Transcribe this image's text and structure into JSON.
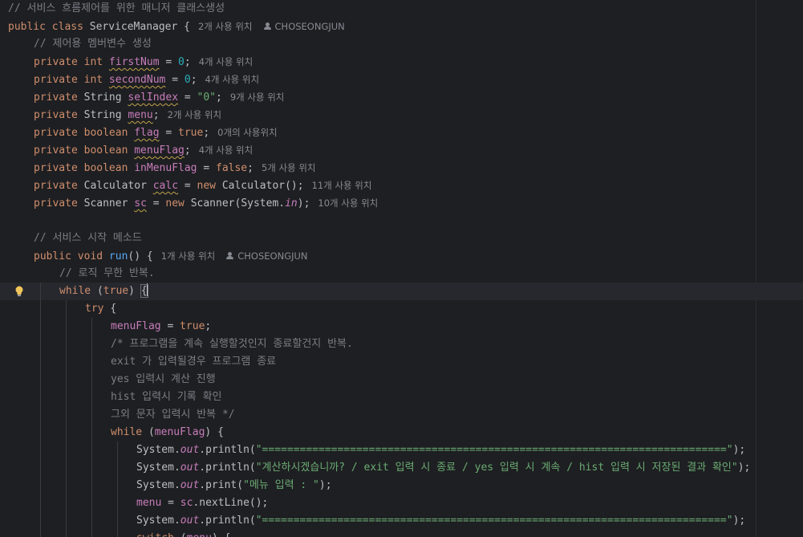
{
  "editor": {
    "lines": [
      {
        "indent": 0,
        "tokens": [
          {
            "t": "// 서비스 흐름제어를 위한 매니저 클래스생성",
            "c": "cmt"
          }
        ]
      },
      {
        "indent": 0,
        "tokens": [
          {
            "t": "public class ",
            "c": "kw"
          },
          {
            "t": "ServiceManager {"
          }
        ],
        "hint": "2개 사용 위치",
        "author": "CHOSEONGJUN"
      },
      {
        "indent": 1,
        "tokens": [
          {
            "t": "// 제어용 멤버변수 생성",
            "c": "cmt"
          }
        ]
      },
      {
        "indent": 1,
        "tokens": [
          {
            "t": "private int ",
            "c": "kw"
          },
          {
            "t": "firstNum",
            "c": "fld",
            "typo": true
          },
          {
            "t": " = "
          },
          {
            "t": "0",
            "c": "num"
          },
          {
            "t": ";"
          }
        ],
        "hint": "4개 사용 위치"
      },
      {
        "indent": 1,
        "tokens": [
          {
            "t": "private int ",
            "c": "kw"
          },
          {
            "t": "secondNum",
            "c": "fld",
            "typo": true
          },
          {
            "t": " = "
          },
          {
            "t": "0",
            "c": "num"
          },
          {
            "t": ";"
          }
        ],
        "hint": "4개 사용 위치"
      },
      {
        "indent": 1,
        "tokens": [
          {
            "t": "private ",
            "c": "kw"
          },
          {
            "t": "String "
          },
          {
            "t": "selIndex",
            "c": "fld",
            "typo": true
          },
          {
            "t": " = "
          },
          {
            "t": "\"0\"",
            "c": "str"
          },
          {
            "t": ";"
          }
        ],
        "hint": "9개 사용 위치"
      },
      {
        "indent": 1,
        "tokens": [
          {
            "t": "private ",
            "c": "kw"
          },
          {
            "t": "String "
          },
          {
            "t": "menu",
            "c": "fld",
            "typo": true
          },
          {
            "t": ";"
          }
        ],
        "hint": "2개 사용 위치"
      },
      {
        "indent": 1,
        "tokens": [
          {
            "t": "private boolean ",
            "c": "kw"
          },
          {
            "t": "flag",
            "c": "fld",
            "typo": true
          },
          {
            "t": " = "
          },
          {
            "t": "true",
            "c": "kw"
          },
          {
            "t": ";"
          }
        ],
        "hint": "0개의 사용위치"
      },
      {
        "indent": 1,
        "tokens": [
          {
            "t": "private boolean ",
            "c": "kw"
          },
          {
            "t": "menuFlag",
            "c": "fld",
            "typo": true
          },
          {
            "t": ";"
          }
        ],
        "hint": "4개 사용 위치"
      },
      {
        "indent": 1,
        "tokens": [
          {
            "t": "private boolean ",
            "c": "kw"
          },
          {
            "t": "inMenuFlag",
            "c": "fld"
          },
          {
            "t": " = "
          },
          {
            "t": "false",
            "c": "kw"
          },
          {
            "t": ";"
          }
        ],
        "hint": "5개 사용 위치"
      },
      {
        "indent": 1,
        "tokens": [
          {
            "t": "private ",
            "c": "kw"
          },
          {
            "t": "Calculator "
          },
          {
            "t": "calc",
            "c": "fld",
            "typo": true
          },
          {
            "t": " = "
          },
          {
            "t": "new ",
            "c": "kw"
          },
          {
            "t": "Calculator();"
          }
        ],
        "hint": "11개 사용 위치"
      },
      {
        "indent": 1,
        "tokens": [
          {
            "t": "private ",
            "c": "kw"
          },
          {
            "t": "Scanner "
          },
          {
            "t": "sc",
            "c": "fld",
            "typo": true
          },
          {
            "t": " = "
          },
          {
            "t": "new ",
            "c": "kw"
          },
          {
            "t": "Scanner(System."
          },
          {
            "t": "in",
            "c": "static"
          },
          {
            "t": ");"
          }
        ],
        "hint": "10개 사용 위치"
      },
      {
        "indent": 0,
        "tokens": []
      },
      {
        "indent": 1,
        "tokens": [
          {
            "t": "// 서비스 시작 메소드",
            "c": "cmt"
          }
        ]
      },
      {
        "indent": 1,
        "tokens": [
          {
            "t": "public void ",
            "c": "kw"
          },
          {
            "t": "run",
            "c": "fn"
          },
          {
            "t": "() {"
          }
        ],
        "hint": "1개 사용 위치",
        "author": "CHOSEONGJUN"
      },
      {
        "indent": 2,
        "tokens": [
          {
            "t": "// 로직 무한 반복.",
            "c": "cmt"
          }
        ]
      },
      {
        "indent": 2,
        "tokens": [
          {
            "t": "while ",
            "c": "kw"
          },
          {
            "t": "("
          },
          {
            "t": "true",
            "c": "kw"
          },
          {
            "t": ") "
          },
          {
            "t": "{",
            "hl": true
          }
        ],
        "current": true,
        "bulb": true
      },
      {
        "indent": 3,
        "tokens": [
          {
            "t": "try ",
            "c": "kw"
          },
          {
            "t": "{"
          }
        ]
      },
      {
        "indent": 4,
        "tokens": [
          {
            "t": "menuFlag",
            "c": "fld"
          },
          {
            "t": " = "
          },
          {
            "t": "true",
            "c": "kw"
          },
          {
            "t": ";"
          }
        ]
      },
      {
        "indent": 4,
        "tokens": [
          {
            "t": "/* 프로그램을 계속 실행할것인지 종료할건지 반복.",
            "c": "cmt"
          }
        ]
      },
      {
        "indent": 4,
        "tokens": [
          {
            "t": "exit 가 입력될경우 프로그램 종료",
            "c": "cmt"
          }
        ]
      },
      {
        "indent": 4,
        "tokens": [
          {
            "t": "yes 입력시 계산 진행",
            "c": "cmt"
          }
        ]
      },
      {
        "indent": 4,
        "tokens": [
          {
            "t": "hist 입력시 기록 확인",
            "c": "cmt"
          }
        ]
      },
      {
        "indent": 4,
        "tokens": [
          {
            "t": "그외 문자 입력시 반복 */",
            "c": "cmt"
          }
        ]
      },
      {
        "indent": 4,
        "tokens": [
          {
            "t": "while ",
            "c": "kw"
          },
          {
            "t": "("
          },
          {
            "t": "menuFlag",
            "c": "fld"
          },
          {
            "t": ") {"
          }
        ]
      },
      {
        "indent": 5,
        "tokens": [
          {
            "t": "System."
          },
          {
            "t": "out",
            "c": "static"
          },
          {
            "t": ".println("
          },
          {
            "t": "\"==========================================================================\"",
            "c": "str"
          },
          {
            "t": ");"
          }
        ]
      },
      {
        "indent": 5,
        "tokens": [
          {
            "t": "System."
          },
          {
            "t": "out",
            "c": "static"
          },
          {
            "t": ".println("
          },
          {
            "t": "\"계산하시겠습니까? / exit 입력 시 종료 / yes 입력 시 계속 / hist 입력 시 저장된 결과 확인\"",
            "c": "str"
          },
          {
            "t": ");"
          }
        ]
      },
      {
        "indent": 5,
        "tokens": [
          {
            "t": "System."
          },
          {
            "t": "out",
            "c": "static"
          },
          {
            "t": ".print("
          },
          {
            "t": "\"메뉴 입력 : \"",
            "c": "str"
          },
          {
            "t": ");"
          }
        ]
      },
      {
        "indent": 5,
        "tokens": [
          {
            "t": "menu",
            "c": "fld"
          },
          {
            "t": " = "
          },
          {
            "t": "sc",
            "c": "fld"
          },
          {
            "t": ".nextLine();"
          }
        ]
      },
      {
        "indent": 5,
        "tokens": [
          {
            "t": "System."
          },
          {
            "t": "out",
            "c": "static"
          },
          {
            "t": ".println("
          },
          {
            "t": "\"==========================================================================\"",
            "c": "str"
          },
          {
            "t": ");"
          }
        ]
      },
      {
        "indent": 5,
        "tokens": [
          {
            "t": "switch ",
            "c": "kw"
          },
          {
            "t": "("
          },
          {
            "t": "menu",
            "c": "fld"
          },
          {
            "t": ") {"
          }
        ]
      }
    ]
  }
}
